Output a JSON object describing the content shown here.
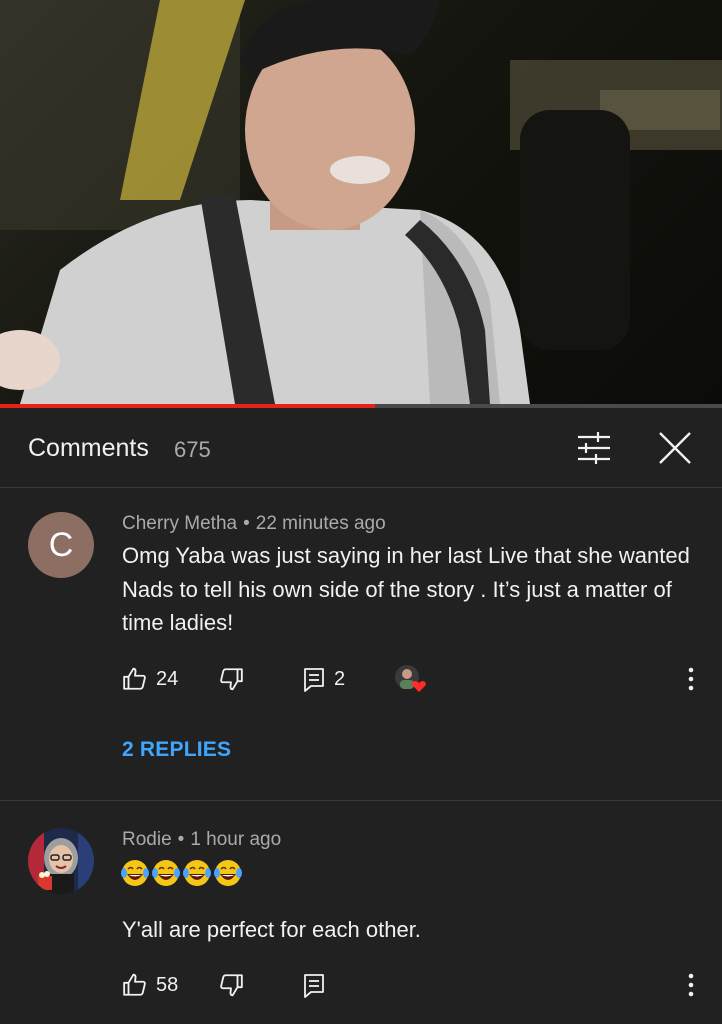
{
  "video": {
    "description_icon": "video-thumbnail",
    "progress_fraction": 0.52,
    "progress_color": "#e62117"
  },
  "header": {
    "title": "Comments",
    "count": "675",
    "filter_icon": "sliders-icon",
    "close_icon": "close-icon"
  },
  "comments": [
    {
      "avatar_letter": "C",
      "avatar_color": "#8d6e63",
      "author": "Cherry Metha",
      "separator": "•",
      "time": "22 minutes ago",
      "text": "Omg Yaba was just saying in her last Live that she wanted Nads to tell his own side of the story .  It’s just a matter of time ladies!",
      "likes": "24",
      "reply_count": "2",
      "replies_link": "2 REPLIES"
    },
    {
      "author": "Rodie",
      "separator": "•",
      "time": "1 hour ago",
      "emoji": "😂😂😂😂",
      "text": "Y'all are perfect for each other.",
      "likes": "58"
    }
  ],
  "colors": {
    "background": "#212121",
    "link": "#3ea6ff",
    "secondary_text": "#aaaaaa"
  }
}
